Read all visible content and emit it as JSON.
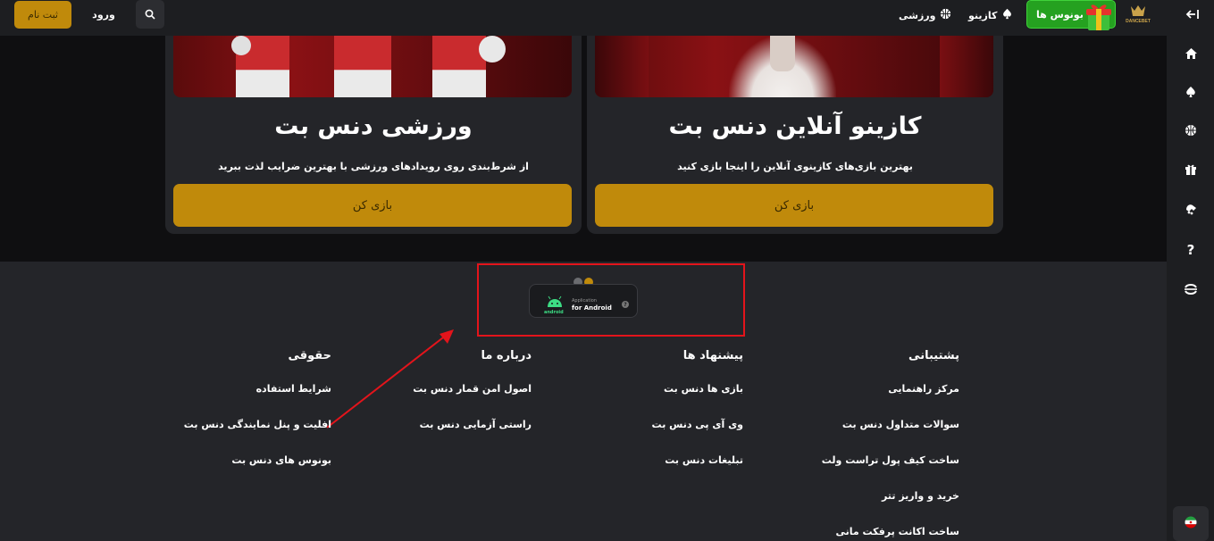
{
  "header": {
    "register_label": "ثبت نام",
    "login_label": "ورود",
    "nav_sports": "ورزشی",
    "nav_casino": "کازینو",
    "bonus_label": "بونوس ها",
    "logo_text": "DANCEBET"
  },
  "cards": [
    {
      "title": "کازینو آنلاین دنس بت",
      "description": "بهترین بازی‌های کازینوی آنلاین را اینجا بازی کنید",
      "button": "بازی کن"
    },
    {
      "title": "ورزشی دنس بت",
      "description": "از شرط‌بندی روی رویدادهای ورزشی با بهترین ضرایب لذت ببرید",
      "button": "بازی کن"
    }
  ],
  "app_badge": {
    "small_text": "Application",
    "big_text": "for Android",
    "os_text": "android"
  },
  "footer": {
    "support": {
      "title": "پشتیبانی",
      "links": [
        "مرکز راهنمایی",
        "سوالات متداول دنس بت",
        "ساخت کیف پول تراست ولت",
        "خرید و واریز تتر",
        "ساخت اکانت پرفکت مانی"
      ]
    },
    "offers": {
      "title": "پیشنهاد ها",
      "links": [
        "بازی ها دنس بت",
        "وی آی پی دنس بت",
        "تبلیغات دنس بت"
      ]
    },
    "about": {
      "title": "درباره ما",
      "links": [
        "اصول امن قمار دنس بت",
        "راستی آزمایی دنس بت"
      ]
    },
    "legal": {
      "title": "حقوقی",
      "links": [
        "شرایط استفاده",
        "افلیت و پنل نمایندگی دنس بت",
        "بونوس های دنس بت"
      ]
    }
  },
  "colors": {
    "accent": "#c08a0b",
    "green": "#25a120",
    "highlight": "#e3141b"
  }
}
